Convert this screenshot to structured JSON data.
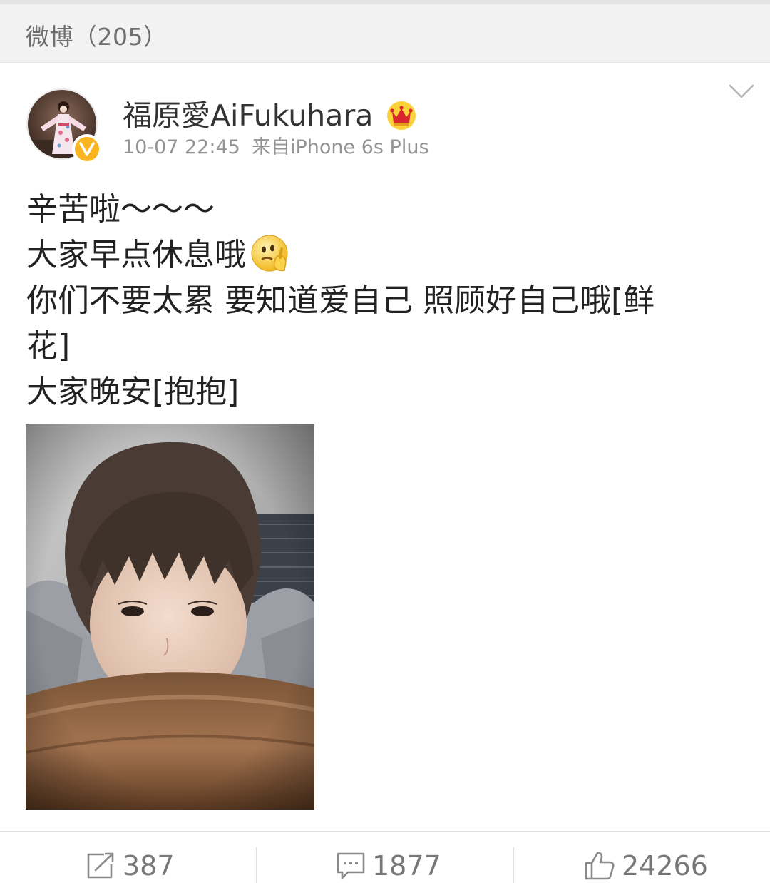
{
  "section": {
    "title": "微博（205）"
  },
  "post": {
    "user_name": "福原愛AiFukuhara",
    "time": "10-07 22:45",
    "source": "来自iPhone 6s Plus",
    "verified_letter": "V",
    "body_lines": [
      "辛苦啦～～～",
      "大家早点休息哦",
      "你们不要太累 要知道爱自己 照顾好自己哦[鲜",
      "花]",
      "大家晚安[抱抱]"
    ]
  },
  "actions": {
    "repost_count": "387",
    "comment_count": "1877",
    "like_count": "24266"
  },
  "colors": {
    "verified": "#f8b421",
    "muted_text": "#939393",
    "header_bg": "#f2f2f2"
  },
  "icons": {
    "crown": "crown-icon",
    "more": "chevron-down-icon",
    "emoji": "thinking-face-icon",
    "repost": "repost-icon",
    "comment": "comment-icon",
    "like": "thumbs-up-icon"
  }
}
